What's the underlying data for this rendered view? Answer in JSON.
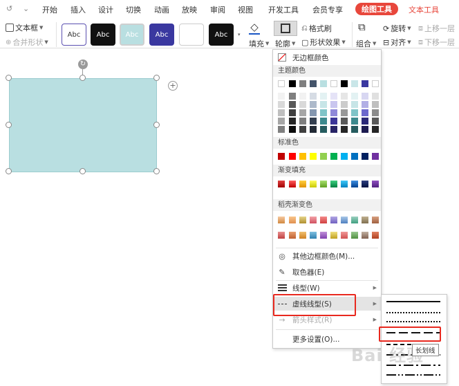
{
  "tabs": {
    "quick_icons": [
      "↺",
      "⌄"
    ],
    "items": [
      "开始",
      "插入",
      "设计",
      "切换",
      "动画",
      "放映",
      "审阅",
      "视图",
      "开发工具",
      "会员专享"
    ],
    "active": "绘图工具",
    "text_tools": "文本工具"
  },
  "ribbon": {
    "textbox": "文本框",
    "merge_shape": "合并形状",
    "style_label": "Abc",
    "fill": "填充",
    "outline": "轮廓",
    "format_painter": "格式刷",
    "shape_effects": "形状效果",
    "group": "组合",
    "rotate": "旋转",
    "align": "对齐",
    "bring_forward": "上移一层",
    "send_backward": "下移一层"
  },
  "outline_menu": {
    "no_border": "无边框颜色",
    "theme_colors": "主题颜色",
    "standard_colors": "标准色",
    "gradient_fill": "渐变填充",
    "docer_gradient": "稻壳渐变色",
    "more_colors": "其他边框颜色(M)...",
    "eyedropper": "取色器(E)",
    "line_type": "线型(W)",
    "dash_type": "虚线线型(S)",
    "arrow_style": "箭头样式(R)",
    "more_settings": "更多设置(O)..."
  },
  "dash_submenu": {
    "tooltip": "长划线"
  },
  "watermark": "Bai 经验",
  "colors": {
    "accent_red": "#e8473c",
    "highlight_red": "#e8281e",
    "shape_fill": "#b9dfe1"
  },
  "icons": [
    "undo-icon",
    "textbox-icon",
    "fill-icon",
    "outline-icon",
    "format-painter-icon",
    "shape-effects-icon",
    "group-icon",
    "rotate-icon",
    "align-icon",
    "no-border-icon",
    "palette-icon",
    "eyedropper-icon",
    "line-type-icon",
    "dash-type-icon",
    "arrow-style-icon"
  ]
}
